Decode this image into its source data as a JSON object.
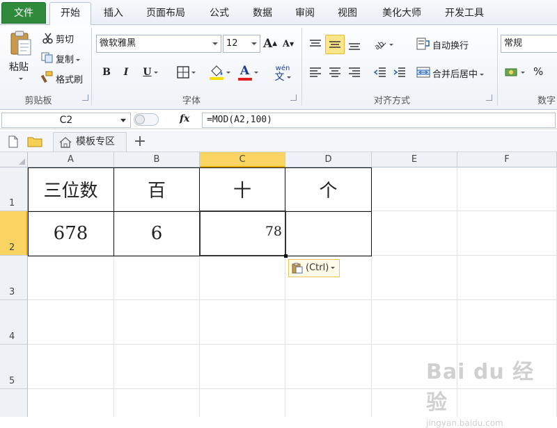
{
  "tabs": [
    {
      "label": "文件"
    },
    {
      "label": "开始"
    },
    {
      "label": "插入"
    },
    {
      "label": "页面布局"
    },
    {
      "label": "公式"
    },
    {
      "label": "数据"
    },
    {
      "label": "审阅"
    },
    {
      "label": "视图"
    },
    {
      "label": "美化大师"
    },
    {
      "label": "开发工具"
    }
  ],
  "clipboard": {
    "paste": "粘贴",
    "cut": "剪切",
    "copy": "复制",
    "format_painter": "格式刷",
    "group": "剪贴板"
  },
  "font": {
    "name": "微软雅黑",
    "size": "12",
    "group": "字体",
    "bold": "B",
    "italic": "I",
    "underline": "U",
    "grow": "A",
    "shrink": "A",
    "font_color": "A",
    "phonetic": "wén",
    "phonetic_char": "文"
  },
  "alignment": {
    "wrap": "自动换行",
    "merge": "合并后居中",
    "group": "对齐方式"
  },
  "number": {
    "format": "常规",
    "percent": "%",
    "group": "数字"
  },
  "formula_bar": {
    "name_box": "C2",
    "fx": "fx",
    "formula": "=MOD(A2,100)"
  },
  "doc_tab": {
    "label": "模板专区",
    "add": "+"
  },
  "columns": [
    "A",
    "B",
    "C",
    "D",
    "E",
    "F"
  ],
  "rows": [
    "1",
    "2",
    "3",
    "4",
    "5"
  ],
  "cells": {
    "A1": "三位数",
    "B1": "百",
    "C1": "十",
    "D1": "个",
    "A2": "678",
    "B2": "6",
    "C2": "78",
    "D2": ""
  },
  "paste_options": {
    "label": "(Ctrl)"
  },
  "watermark": {
    "logo": "Bai du 经验",
    "url": "jingyan.baidu.com"
  },
  "colors": {
    "file_tab": "#2f8a3c",
    "selected_header": "#f9d463",
    "font_color_bar": "#e02020",
    "highlight_bar": "#f4e000"
  }
}
